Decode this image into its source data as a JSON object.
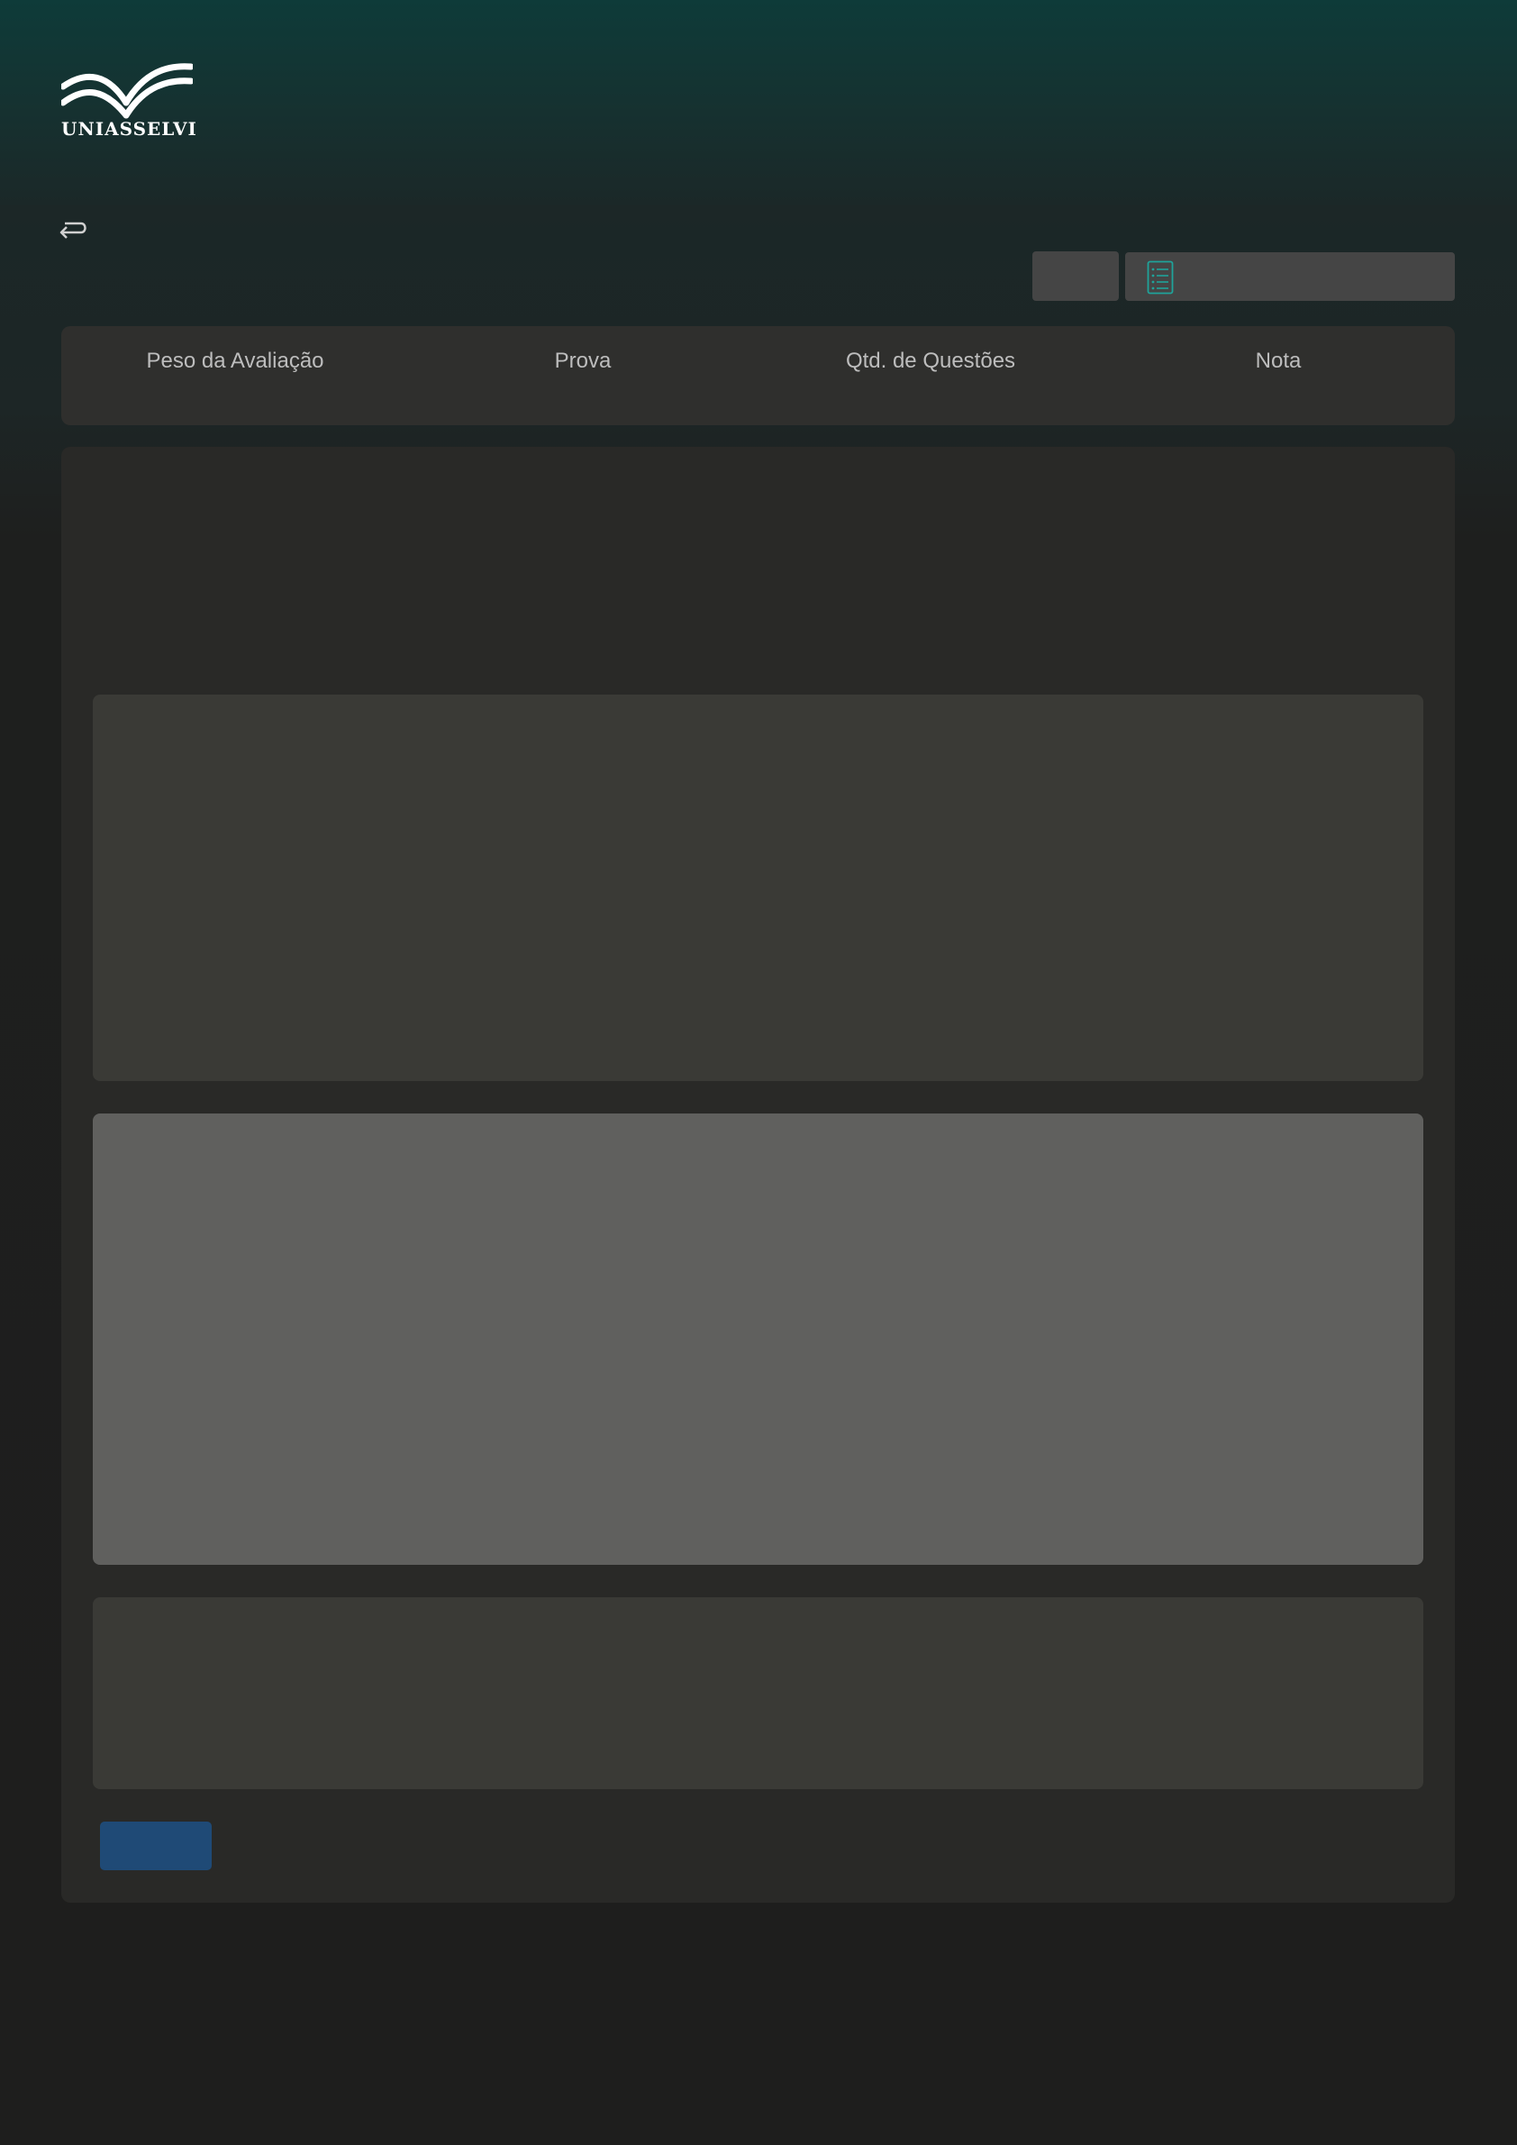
{
  "brand": {
    "logo_text": "UNIASSELVI",
    "logo_color": "#ffffff"
  },
  "icons": {
    "back": "return-arrow-icon",
    "list": "list-document-icon"
  },
  "summary": {
    "columns": [
      {
        "label": "Peso da Avaliação"
      },
      {
        "label": "Prova"
      },
      {
        "label": "Qtd. de Questões"
      },
      {
        "label": "Nota"
      }
    ]
  },
  "colors": {
    "accent_teal": "#1fa39a",
    "primary_button": "#1f4a76",
    "header_gradient_top": "#0e3b39",
    "page_background": "#1e1e1d"
  }
}
